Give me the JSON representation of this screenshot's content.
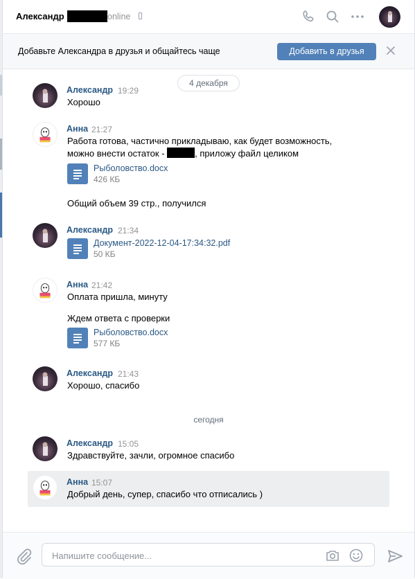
{
  "header": {
    "name": "Александр",
    "status": "online"
  },
  "banner": {
    "text": "Добавьте Александра в друзья и общайтесь чаще",
    "button": "Добавить в друзья"
  },
  "history": {
    "date_1": "4 декабря",
    "date_2": "сегодня",
    "messages": [
      {
        "author": "Александр",
        "time": "19:29",
        "lines": [
          "Хорошо"
        ]
      },
      {
        "author": "Анна",
        "time": "21:27",
        "lines": [
          "Работа готова, частично прикладываю, как будет возможность,",
          "можно внести остаток -",
          ", приложу файл целиком"
        ],
        "doc": {
          "name": "Рыболовство.docx",
          "size": "426 КБ"
        },
        "extra": "Общий объем 39 стр., получился"
      },
      {
        "author": "Александр",
        "time": "21:34",
        "doc": {
          "name": "Документ-2022-12-04-17:34:32.pdf",
          "size": "50 КБ"
        }
      },
      {
        "author": "Анна",
        "time": "21:42",
        "lines": [
          "Оплата пришла, минуту",
          "Ждем ответа с проверки"
        ],
        "doc": {
          "name": "Рыболовство.docx",
          "size": "577 КБ"
        }
      },
      {
        "author": "Александр",
        "time": "21:43",
        "lines": [
          "Хорошо, спасибо"
        ]
      },
      {
        "author": "Александр",
        "time": "15:05",
        "lines": [
          "Здравствуйте, зачли, огромное спасибо"
        ]
      },
      {
        "author": "Анна",
        "time": "15:07",
        "lines": [
          "Добрый день, супер, спасибо что отписались )"
        ]
      }
    ]
  },
  "composer": {
    "placeholder": "Напишите сообщение..."
  },
  "colors": {
    "accent": "#5181b8",
    "link": "#2a5885",
    "highlight": "#edeef0"
  },
  "icons": [
    "phone-icon",
    "search-icon",
    "more-icon",
    "close-icon",
    "document-icon",
    "paperclip-icon",
    "camera-icon",
    "smile-icon",
    "send-icon"
  ]
}
